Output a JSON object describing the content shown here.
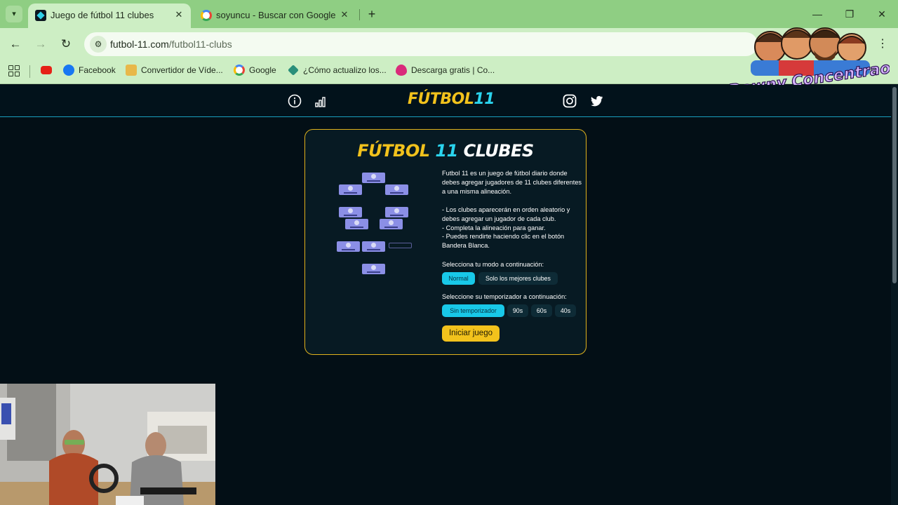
{
  "browser": {
    "tabs": [
      {
        "title": "Juego de fútbol 11 clubes",
        "active": true
      },
      {
        "title": "soyuncu - Buscar con Google",
        "active": false
      }
    ],
    "tab_close": "✕",
    "new_tab": "+",
    "url": {
      "host": "futbol-11.com",
      "path": "/futbol11-clubs"
    },
    "bookmarks": [
      {
        "label": "Facebook",
        "icon": "facebook-icon",
        "color": "#1877f2"
      },
      {
        "label": "Convertidor de Víde...",
        "icon": "converter-icon",
        "color": "#e8b84a"
      },
      {
        "label": "Google",
        "icon": "google-icon",
        "color": "#4285f4"
      },
      {
        "label": "¿Cómo actualizo los...",
        "icon": "diamond-icon",
        "color": "#2a8f7a"
      },
      {
        "label": "Descarga gratis | Co...",
        "icon": "drop-icon",
        "color": "#d92a7a"
      }
    ],
    "overlay_text": "Downy Concentrao"
  },
  "site": {
    "logo": {
      "main": "FÚTBOL",
      "num": "11"
    },
    "card": {
      "title_a": "FÚTBOL",
      "title_b": "11",
      "title_c": "CLUBES",
      "description": [
        "Futbol 11 es un juego de fútbol diario donde debes agregar jugadores de 11 clubes diferentes a una misma alineación.",
        "- Los clubes aparecerán en orden aleatorio y debes agregar un jugador de cada club.",
        "- Completa la alineación para ganar.",
        "- Puedes rendirte haciendo clic en el botón Bandera Blanca."
      ],
      "mode_label": "Selecciona tu modo a continuación:",
      "modes": [
        "Normal",
        "Solo los mejores clubes"
      ],
      "selected_mode": "Normal",
      "timer_label": "Seleccione su temporizador a continuación:",
      "timers": [
        "Sin temporizador",
        "90s",
        "60s",
        "40s"
      ],
      "selected_timer": "Sin temporizador",
      "start_button": "Iniciar juego"
    }
  },
  "colors": {
    "accent_yellow": "#f2c21c",
    "accent_cyan": "#2ad4ee",
    "background": "#030f16"
  }
}
